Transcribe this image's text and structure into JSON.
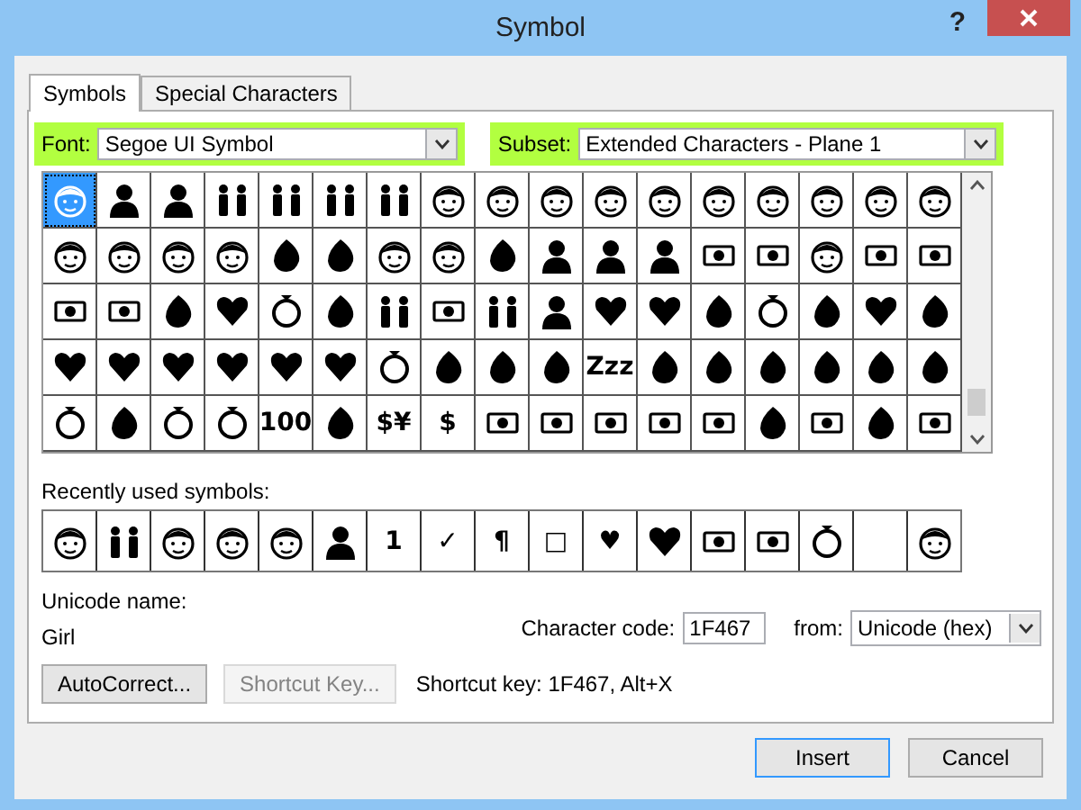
{
  "window": {
    "title": "Symbol",
    "help_button": "?"
  },
  "tabs": [
    {
      "label": "Symbols",
      "selected": true
    },
    {
      "label": "Special Characters",
      "selected": false
    }
  ],
  "font": {
    "label": "Font:",
    "value": "Segoe UI Symbol",
    "highlighted": true
  },
  "subset": {
    "label": "Subset:",
    "value": "Extended Characters - Plane 1",
    "highlighted": true
  },
  "symbol_grid": {
    "cells": [
      {
        "kind": "face",
        "selected": true
      },
      {
        "kind": "person",
        "selected": false
      },
      {
        "kind": "person",
        "selected": false
      },
      {
        "kind": "people",
        "selected": false
      },
      {
        "kind": "people",
        "selected": false
      },
      {
        "kind": "people",
        "selected": false
      },
      {
        "kind": "people",
        "selected": false
      },
      {
        "kind": "face",
        "selected": false
      },
      {
        "kind": "face",
        "selected": false
      },
      {
        "kind": "face",
        "selected": false
      },
      {
        "kind": "face",
        "selected": false
      },
      {
        "kind": "face",
        "selected": false
      },
      {
        "kind": "face",
        "selected": false
      },
      {
        "kind": "face",
        "selected": false
      },
      {
        "kind": "face",
        "selected": false
      },
      {
        "kind": "face",
        "selected": false
      },
      {
        "kind": "face",
        "selected": false
      },
      {
        "kind": "face",
        "selected": false
      },
      {
        "kind": "face",
        "selected": false
      },
      {
        "kind": "face",
        "selected": false
      },
      {
        "kind": "face",
        "selected": false
      },
      {
        "kind": "blob",
        "selected": false
      },
      {
        "kind": "blob",
        "selected": false
      },
      {
        "kind": "face",
        "selected": false
      },
      {
        "kind": "face",
        "selected": false
      },
      {
        "kind": "blob",
        "selected": false
      },
      {
        "kind": "person",
        "selected": false
      },
      {
        "kind": "person",
        "selected": false
      },
      {
        "kind": "person",
        "selected": false
      },
      {
        "kind": "bar",
        "selected": false
      },
      {
        "kind": "bar",
        "selected": false
      },
      {
        "kind": "face",
        "selected": false
      },
      {
        "kind": "bar",
        "selected": false
      },
      {
        "kind": "bar",
        "selected": false
      },
      {
        "kind": "bar",
        "selected": false
      },
      {
        "kind": "bar",
        "selected": false
      },
      {
        "kind": "blob",
        "selected": false
      },
      {
        "kind": "heart",
        "selected": false
      },
      {
        "kind": "ring",
        "selected": false
      },
      {
        "kind": "blob",
        "selected": false
      },
      {
        "kind": "people",
        "selected": false
      },
      {
        "kind": "bar",
        "selected": false
      },
      {
        "kind": "people",
        "selected": false
      },
      {
        "kind": "person",
        "selected": false
      },
      {
        "kind": "heart",
        "selected": false
      },
      {
        "kind": "heart",
        "selected": false
      },
      {
        "kind": "blob",
        "selected": false
      },
      {
        "kind": "ring",
        "selected": false
      },
      {
        "kind": "blob",
        "selected": false
      },
      {
        "kind": "heart",
        "selected": false
      },
      {
        "kind": "blob",
        "selected": false
      },
      {
        "kind": "heart",
        "selected": false
      },
      {
        "kind": "heart",
        "selected": false
      },
      {
        "kind": "heart",
        "selected": false
      },
      {
        "kind": "heart",
        "selected": false
      },
      {
        "kind": "heart",
        "selected": false
      },
      {
        "kind": "heart",
        "selected": false
      },
      {
        "kind": "ring",
        "selected": false
      },
      {
        "kind": "blob",
        "selected": false
      },
      {
        "kind": "blob",
        "selected": false
      },
      {
        "kind": "blob",
        "selected": false
      },
      {
        "kind": "text",
        "char": "Zzz",
        "selected": false
      },
      {
        "kind": "blob",
        "selected": false
      },
      {
        "kind": "blob",
        "selected": false
      },
      {
        "kind": "blob",
        "selected": false
      },
      {
        "kind": "blob",
        "selected": false
      },
      {
        "kind": "blob",
        "selected": false
      },
      {
        "kind": "blob",
        "selected": false
      },
      {
        "kind": "ring",
        "selected": false
      },
      {
        "kind": "blob",
        "selected": false
      },
      {
        "kind": "ring",
        "selected": false
      },
      {
        "kind": "ring",
        "selected": false
      },
      {
        "kind": "text",
        "char": "100",
        "selected": false
      },
      {
        "kind": "blob",
        "selected": false
      },
      {
        "kind": "text",
        "char": "$¥",
        "selected": false
      },
      {
        "kind": "text",
        "char": "$",
        "selected": false
      },
      {
        "kind": "bar",
        "selected": false
      },
      {
        "kind": "bar",
        "selected": false
      },
      {
        "kind": "bar",
        "selected": false
      },
      {
        "kind": "bar",
        "selected": false
      },
      {
        "kind": "bar",
        "selected": false
      },
      {
        "kind": "blob",
        "selected": false
      },
      {
        "kind": "bar",
        "selected": false
      },
      {
        "kind": "blob",
        "selected": false
      },
      {
        "kind": "bar",
        "selected": false
      }
    ]
  },
  "recently_used": {
    "label": "Recently used symbols:",
    "symbols": [
      {
        "kind": "face"
      },
      {
        "kind": "people"
      },
      {
        "kind": "face"
      },
      {
        "kind": "face"
      },
      {
        "kind": "face"
      },
      {
        "kind": "person"
      },
      {
        "kind": "text",
        "char": "1"
      },
      {
        "kind": "text",
        "char": "✓"
      },
      {
        "kind": "text",
        "char": "¶"
      },
      {
        "kind": "text",
        "char": "□"
      },
      {
        "kind": "text",
        "char": "♥"
      },
      {
        "kind": "heart"
      },
      {
        "kind": "bar"
      },
      {
        "kind": "bar"
      },
      {
        "kind": "ring"
      },
      {
        "kind": "blank"
      },
      {
        "kind": "face"
      }
    ]
  },
  "unicode_name": {
    "label": "Unicode name:",
    "value": "Girl"
  },
  "character_code": {
    "label": "Character code:",
    "value": "1F467"
  },
  "from": {
    "label": "from:",
    "value": "Unicode (hex)"
  },
  "autocorrect_button": {
    "label": "AutoCorrect...",
    "disabled": false
  },
  "shortcut_key_button": {
    "label": "Shortcut Key...",
    "disabled": true
  },
  "shortcut_text": "Shortcut key: 1F467, Alt+X",
  "dialog_buttons": [
    {
      "label": "Insert",
      "default": true
    },
    {
      "label": "Cancel",
      "default": false
    }
  ]
}
